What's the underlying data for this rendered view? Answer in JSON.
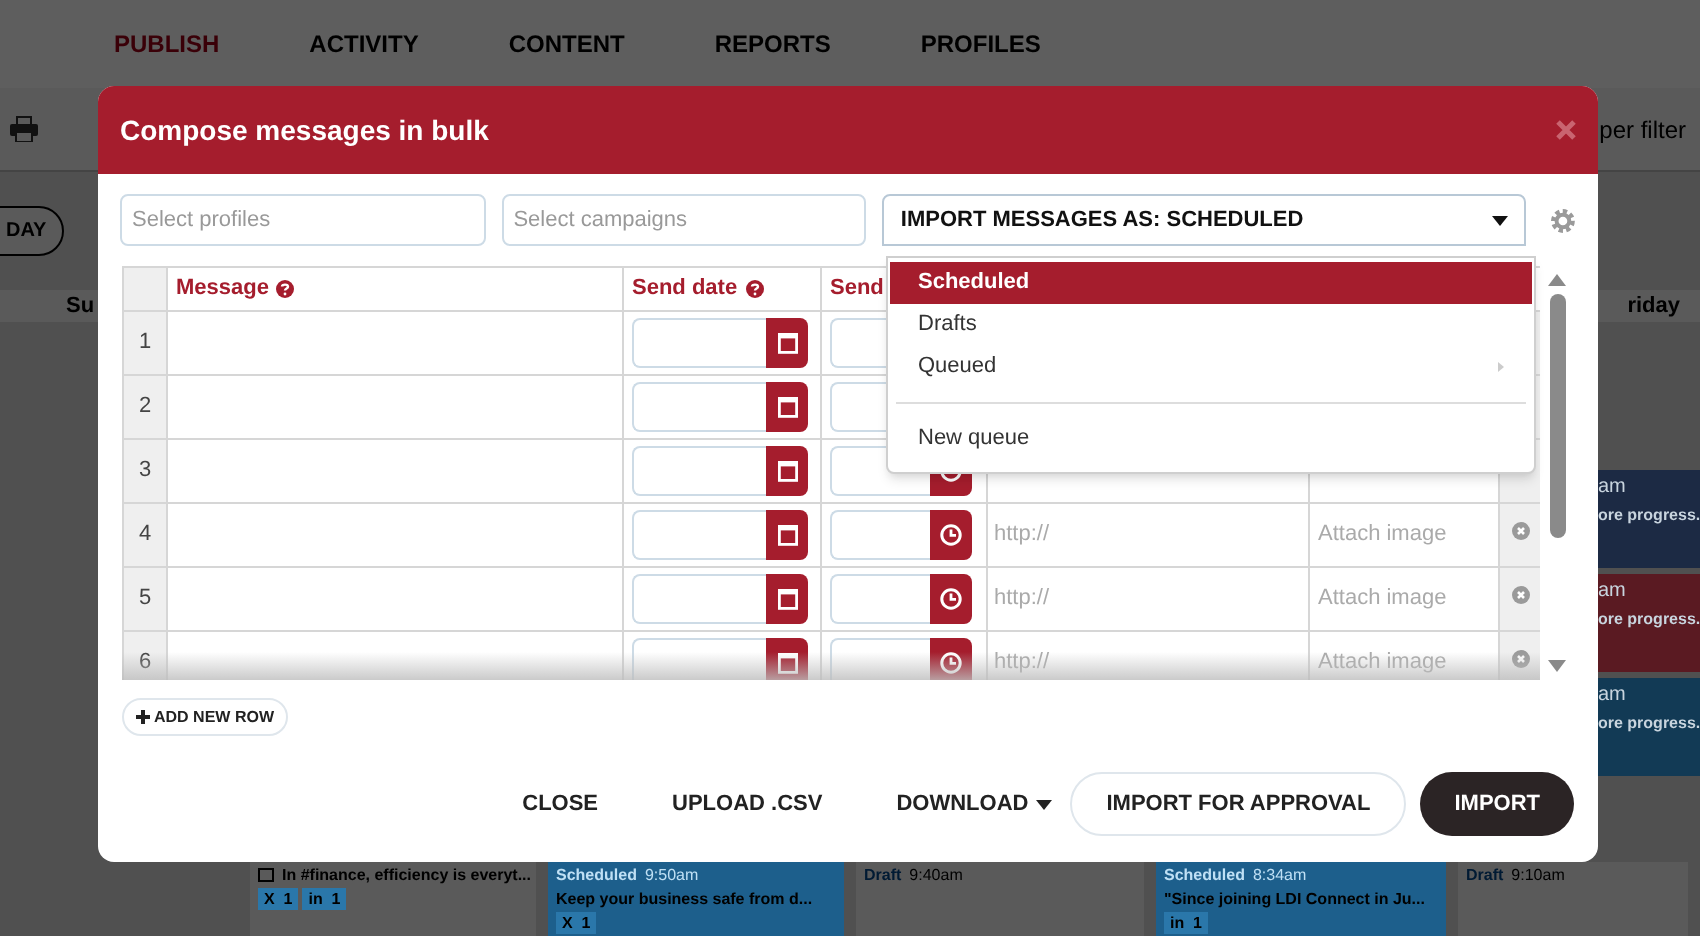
{
  "nav": {
    "tabs": [
      {
        "label": "PUBLISH",
        "selected": true
      },
      {
        "label": "ACTIVITY",
        "selected": false
      },
      {
        "label": "CONTENT",
        "selected": false
      },
      {
        "label": "REPORTS",
        "selected": false
      },
      {
        "label": "PROFILES",
        "selected": false
      }
    ]
  },
  "toolbar": {
    "day_button": "DAY",
    "filter_text": "per filter"
  },
  "calendar": {
    "day_headers": [
      "Su",
      "riday"
    ],
    "side_cards": [
      {
        "time": "am",
        "text": "ore progress.",
        "color": "#1c2a44"
      },
      {
        "time": "am",
        "text": "ore progress.",
        "color": "#5a1a22"
      },
      {
        "time": "am",
        "text": "ore progress.",
        "color": "#123a55"
      }
    ],
    "cards": [
      {
        "kind": "plain",
        "text": "In #finance, efficiency is everyt...",
        "badges": [
          "X  1",
          "in  1"
        ]
      },
      {
        "kind": "blue",
        "status": "Scheduled",
        "time": "9:50am",
        "text": "Keep your business safe from d...",
        "badges": [
          "X  1"
        ]
      },
      {
        "kind": "plain",
        "status": "Draft",
        "time": "9:40am"
      },
      {
        "kind": "blue",
        "status": "Scheduled",
        "time": "8:34am",
        "text": "\"Since joining LDI Connect in Ju...",
        "badges": [
          "in  1"
        ]
      },
      {
        "kind": "plain",
        "status": "Draft",
        "time": "9:10am"
      }
    ]
  },
  "modal": {
    "title": "Compose messages in bulk",
    "profiles_placeholder": "Select profiles",
    "campaigns_placeholder": "Select campaigns",
    "import_select": {
      "value": "IMPORT MESSAGES AS: SCHEDULED",
      "expanded": true,
      "options": [
        {
          "label": "Scheduled",
          "selected": true,
          "has_submenu": false
        },
        {
          "label": "Drafts",
          "selected": false,
          "has_submenu": false
        },
        {
          "label": "Queued",
          "selected": false,
          "has_submenu": true
        }
      ],
      "extra_option": "New queue"
    },
    "table": {
      "columns": [
        {
          "label": "Message",
          "help": true
        },
        {
          "label": "Send date",
          "help": true
        },
        {
          "label": "Send",
          "help": false
        }
      ],
      "rows": [
        {
          "number": "1"
        },
        {
          "number": "2"
        },
        {
          "number": "3"
        },
        {
          "number": "4",
          "url_placeholder": "http://",
          "attach": "Attach image"
        },
        {
          "number": "5",
          "url_placeholder": "http://",
          "attach": "Attach image"
        },
        {
          "number": "6",
          "url_placeholder": "http://",
          "attach": "Attach image"
        }
      ]
    },
    "add_row": "ADD NEW ROW",
    "buttons": [
      {
        "label": "CLOSE",
        "kind": "text"
      },
      {
        "label": "UPLOAD .CSV",
        "kind": "text"
      },
      {
        "label": "DOWNLOAD",
        "kind": "dropdown"
      },
      {
        "label": "IMPORT FOR APPROVAL",
        "kind": "outline"
      },
      {
        "label": "IMPORT",
        "kind": "dark"
      }
    ]
  }
}
